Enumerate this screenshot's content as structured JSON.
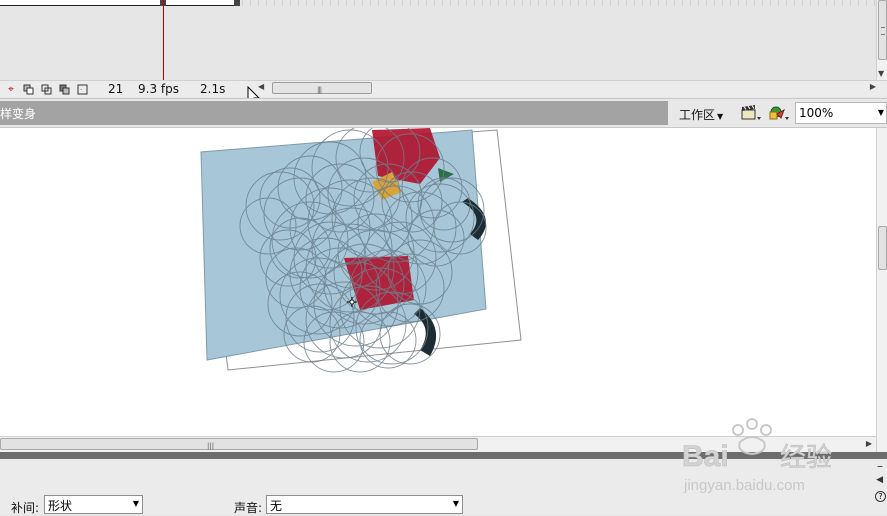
{
  "timeline": {
    "current_frame": "21",
    "frame_rate": "9.3 fps",
    "elapsed_time": "2.1s",
    "icons": [
      "center-frame-icon",
      "onion-skin-icon",
      "onion-skin-outlines-icon",
      "edit-multiple-frames-icon",
      "modify-onion-markers-icon"
    ]
  },
  "editbar": {
    "scene_name": "样变身",
    "workspace_label": "工作区",
    "zoom": "100%"
  },
  "properties": {
    "tween_label": "补间:",
    "tween_value": "形状",
    "sound_label": "声音:",
    "sound_value": "无"
  },
  "watermark": {
    "brand": "Bai",
    "brand_suffix": "经验",
    "url": "jingyan.baidu.com"
  },
  "colors": {
    "playhead": "#c00000",
    "shape_fill": "#a7c7d9",
    "shape_stroke": "#7a8f9a",
    "accent_red": "#b0102a"
  }
}
